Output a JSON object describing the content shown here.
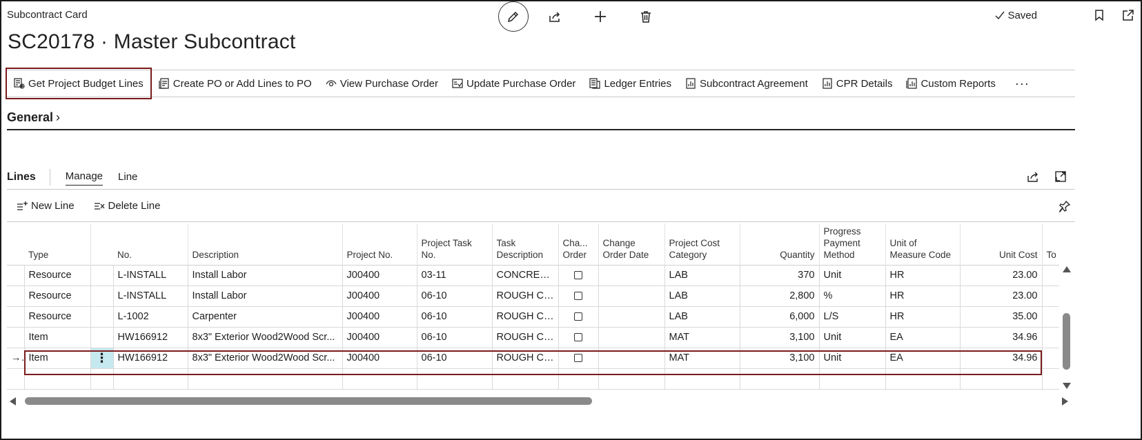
{
  "header": {
    "breadcrumb": "Subcontract Card",
    "status": "Saved",
    "title": "SC20178 · Master Subcontract",
    "icons": [
      "edit-icon",
      "share-icon",
      "add-icon",
      "delete-icon",
      "checkmark-icon",
      "bookmark-icon",
      "open-new-window-icon"
    ]
  },
  "actions": {
    "get_budget_lines": "Get Project Budget Lines",
    "create_po": "Create PO or Add Lines to PO",
    "view_po": "View Purchase Order",
    "update_po": "Update Purchase Order",
    "ledger": "Ledger Entries",
    "agreement": "Subcontract Agreement",
    "cpr": "CPR Details",
    "custom_reports": "Custom Reports",
    "more": "···"
  },
  "general": {
    "label": "General",
    "chevron": "›"
  },
  "lines": {
    "title": "Lines",
    "tabs": [
      "Manage",
      "Line"
    ],
    "new_line": "New Line",
    "delete_line": "Delete Line"
  },
  "grid": {
    "columns": [
      "Type",
      "No.",
      "Description",
      "Project No.",
      "Project Task No.",
      "Task Description",
      "Cha... Order",
      "Change Order Date",
      "Project Cost Category",
      "Quantity",
      "Progress Payment Method",
      "Unit of Measure Code",
      "Unit Cost",
      "To"
    ],
    "rows": [
      {
        "type": "Resource",
        "no": "L-INSTALL",
        "description": "Install Labor",
        "project_no": "J00400",
        "task_no": "03-11",
        "task_desc": "CONCRETE...",
        "co_date": "",
        "cost_cat": "LAB",
        "qty": "370",
        "ppm": "Unit",
        "uom": "HR",
        "unit_cost": "23.00"
      },
      {
        "type": "Resource",
        "no": "L-INSTALL",
        "description": "Install Labor",
        "project_no": "J00400",
        "task_no": "06-10",
        "task_desc": "ROUGH CA...",
        "co_date": "",
        "cost_cat": "LAB",
        "qty": "2,800",
        "ppm": "%",
        "uom": "HR",
        "unit_cost": "23.00"
      },
      {
        "type": "Resource",
        "no": "L-1002",
        "description": "Carpenter",
        "project_no": "J00400",
        "task_no": "06-10",
        "task_desc": "ROUGH CA...",
        "co_date": "",
        "cost_cat": "LAB",
        "qty": "6,000",
        "ppm": "L/S",
        "uom": "HR",
        "unit_cost": "35.00"
      },
      {
        "type": "Item",
        "no": "HW166912",
        "description": "8x3\" Exterior Wood2Wood Scr...",
        "project_no": "J00400",
        "task_no": "06-10",
        "task_desc": "ROUGH CA...",
        "co_date": "",
        "cost_cat": "MAT",
        "qty": "3,100",
        "ppm": "Unit",
        "uom": "EA",
        "unit_cost": "34.96"
      },
      {
        "type": "Item",
        "no": "HW166912",
        "description": "8x3\" Exterior Wood2Wood Scr...",
        "project_no": "J00400",
        "task_no": "06-10",
        "task_desc": "ROUGH CA...",
        "co_date": "",
        "cost_cat": "MAT",
        "qty": "3,100",
        "ppm": "Unit",
        "uom": "EA",
        "unit_cost": "34.96"
      }
    ],
    "selected_indicator": "→",
    "row_menu": "⋮"
  }
}
